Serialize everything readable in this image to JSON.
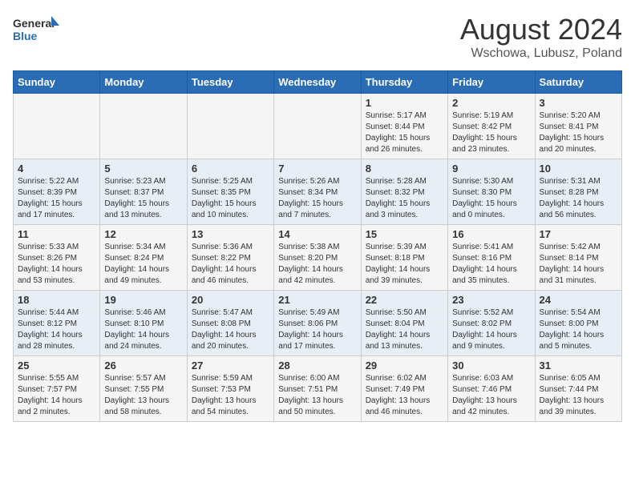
{
  "header": {
    "logo_general": "General",
    "logo_blue": "Blue",
    "month_year": "August 2024",
    "location": "Wschowa, Lubusz, Poland"
  },
  "days_of_week": [
    "Sunday",
    "Monday",
    "Tuesday",
    "Wednesday",
    "Thursday",
    "Friday",
    "Saturday"
  ],
  "weeks": [
    [
      {
        "day": "",
        "info": ""
      },
      {
        "day": "",
        "info": ""
      },
      {
        "day": "",
        "info": ""
      },
      {
        "day": "",
        "info": ""
      },
      {
        "day": "1",
        "info": "Sunrise: 5:17 AM\nSunset: 8:44 PM\nDaylight: 15 hours\nand 26 minutes."
      },
      {
        "day": "2",
        "info": "Sunrise: 5:19 AM\nSunset: 8:42 PM\nDaylight: 15 hours\nand 23 minutes."
      },
      {
        "day": "3",
        "info": "Sunrise: 5:20 AM\nSunset: 8:41 PM\nDaylight: 15 hours\nand 20 minutes."
      }
    ],
    [
      {
        "day": "4",
        "info": "Sunrise: 5:22 AM\nSunset: 8:39 PM\nDaylight: 15 hours\nand 17 minutes."
      },
      {
        "day": "5",
        "info": "Sunrise: 5:23 AM\nSunset: 8:37 PM\nDaylight: 15 hours\nand 13 minutes."
      },
      {
        "day": "6",
        "info": "Sunrise: 5:25 AM\nSunset: 8:35 PM\nDaylight: 15 hours\nand 10 minutes."
      },
      {
        "day": "7",
        "info": "Sunrise: 5:26 AM\nSunset: 8:34 PM\nDaylight: 15 hours\nand 7 minutes."
      },
      {
        "day": "8",
        "info": "Sunrise: 5:28 AM\nSunset: 8:32 PM\nDaylight: 15 hours\nand 3 minutes."
      },
      {
        "day": "9",
        "info": "Sunrise: 5:30 AM\nSunset: 8:30 PM\nDaylight: 15 hours\nand 0 minutes."
      },
      {
        "day": "10",
        "info": "Sunrise: 5:31 AM\nSunset: 8:28 PM\nDaylight: 14 hours\nand 56 minutes."
      }
    ],
    [
      {
        "day": "11",
        "info": "Sunrise: 5:33 AM\nSunset: 8:26 PM\nDaylight: 14 hours\nand 53 minutes."
      },
      {
        "day": "12",
        "info": "Sunrise: 5:34 AM\nSunset: 8:24 PM\nDaylight: 14 hours\nand 49 minutes."
      },
      {
        "day": "13",
        "info": "Sunrise: 5:36 AM\nSunset: 8:22 PM\nDaylight: 14 hours\nand 46 minutes."
      },
      {
        "day": "14",
        "info": "Sunrise: 5:38 AM\nSunset: 8:20 PM\nDaylight: 14 hours\nand 42 minutes."
      },
      {
        "day": "15",
        "info": "Sunrise: 5:39 AM\nSunset: 8:18 PM\nDaylight: 14 hours\nand 39 minutes."
      },
      {
        "day": "16",
        "info": "Sunrise: 5:41 AM\nSunset: 8:16 PM\nDaylight: 14 hours\nand 35 minutes."
      },
      {
        "day": "17",
        "info": "Sunrise: 5:42 AM\nSunset: 8:14 PM\nDaylight: 14 hours\nand 31 minutes."
      }
    ],
    [
      {
        "day": "18",
        "info": "Sunrise: 5:44 AM\nSunset: 8:12 PM\nDaylight: 14 hours\nand 28 minutes."
      },
      {
        "day": "19",
        "info": "Sunrise: 5:46 AM\nSunset: 8:10 PM\nDaylight: 14 hours\nand 24 minutes."
      },
      {
        "day": "20",
        "info": "Sunrise: 5:47 AM\nSunset: 8:08 PM\nDaylight: 14 hours\nand 20 minutes."
      },
      {
        "day": "21",
        "info": "Sunrise: 5:49 AM\nSunset: 8:06 PM\nDaylight: 14 hours\nand 17 minutes."
      },
      {
        "day": "22",
        "info": "Sunrise: 5:50 AM\nSunset: 8:04 PM\nDaylight: 14 hours\nand 13 minutes."
      },
      {
        "day": "23",
        "info": "Sunrise: 5:52 AM\nSunset: 8:02 PM\nDaylight: 14 hours\nand 9 minutes."
      },
      {
        "day": "24",
        "info": "Sunrise: 5:54 AM\nSunset: 8:00 PM\nDaylight: 14 hours\nand 5 minutes."
      }
    ],
    [
      {
        "day": "25",
        "info": "Sunrise: 5:55 AM\nSunset: 7:57 PM\nDaylight: 14 hours\nand 2 minutes."
      },
      {
        "day": "26",
        "info": "Sunrise: 5:57 AM\nSunset: 7:55 PM\nDaylight: 13 hours\nand 58 minutes."
      },
      {
        "day": "27",
        "info": "Sunrise: 5:59 AM\nSunset: 7:53 PM\nDaylight: 13 hours\nand 54 minutes."
      },
      {
        "day": "28",
        "info": "Sunrise: 6:00 AM\nSunset: 7:51 PM\nDaylight: 13 hours\nand 50 minutes."
      },
      {
        "day": "29",
        "info": "Sunrise: 6:02 AM\nSunset: 7:49 PM\nDaylight: 13 hours\nand 46 minutes."
      },
      {
        "day": "30",
        "info": "Sunrise: 6:03 AM\nSunset: 7:46 PM\nDaylight: 13 hours\nand 42 minutes."
      },
      {
        "day": "31",
        "info": "Sunrise: 6:05 AM\nSunset: 7:44 PM\nDaylight: 13 hours\nand 39 minutes."
      }
    ]
  ]
}
